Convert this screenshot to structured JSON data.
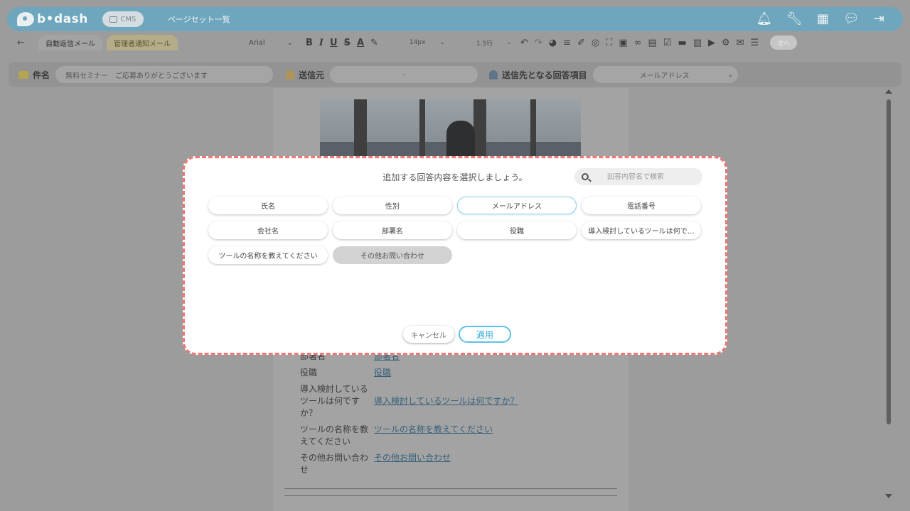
{
  "header": {
    "logo_text": "b•dash",
    "cms_label": "CMS",
    "page_title": "ページセット一覧",
    "icons": [
      "bell-icon",
      "wrench-icon",
      "grid-icon",
      "chat-icon",
      "logout-icon"
    ]
  },
  "toolbar": {
    "back": "←",
    "tabs": [
      {
        "label": "自動返信メール",
        "active": true
      },
      {
        "label": "管理者通知メール",
        "active": false
      }
    ],
    "font_family": "Arial",
    "font_size": "14px",
    "line_height": "1.5行",
    "next_label": "次へ"
  },
  "form": {
    "subject_label": "件名",
    "subject_value": "無料セミナー　ご応募ありがとうございます",
    "sender_label": "送信元",
    "sender_value": "-",
    "recipient_label": "送信先となる回答項目",
    "recipient_value": "メールアドレス"
  },
  "document": {
    "answers": [
      {
        "key": "部署名",
        "value": "部署名"
      },
      {
        "key": "役職",
        "value": "役職"
      },
      {
        "key": "導入検討している ツールは何です か？",
        "value": "導入検討しているツールは何ですか？"
      },
      {
        "key": "ツールの名称を教 えてください",
        "value": "ツールの名称を教えてください"
      },
      {
        "key": "その他お問い合わ せ",
        "value": "その他お問い合わせ"
      }
    ]
  },
  "modal": {
    "title": "追加する回答内容を選択しましょう。",
    "search_placeholder": "回答内容名で検索",
    "chips": [
      {
        "label": "氏名",
        "state": "normal"
      },
      {
        "label": "性別",
        "state": "normal"
      },
      {
        "label": "メールアドレス",
        "state": "selected"
      },
      {
        "label": "電話番号",
        "state": "normal"
      },
      {
        "label": "会社名",
        "state": "normal"
      },
      {
        "label": "部署名",
        "state": "normal"
      },
      {
        "label": "役職",
        "state": "normal"
      },
      {
        "label": "導入検討しているツールは何で…",
        "state": "normal"
      },
      {
        "label": "ツールの名称を教えてください",
        "state": "normal"
      },
      {
        "label": "その他お問い合わせ",
        "state": "disabled"
      }
    ],
    "cancel_label": "キャンセル",
    "apply_label": "適用"
  },
  "colors": {
    "header_bg": "#6ea6bd",
    "modal_border": "#f07878",
    "apply_accent": "#2ba9d8",
    "selected_border": "#8fd0e8"
  }
}
